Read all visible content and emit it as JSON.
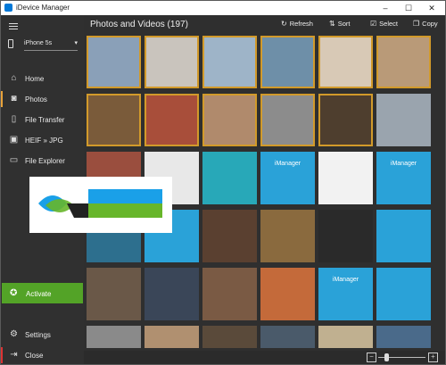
{
  "window": {
    "title": "iDevice Manager",
    "controls": [
      "–",
      "☐",
      "✕"
    ]
  },
  "sidebar": {
    "device": {
      "name": "iPhone 5s"
    },
    "nav": [
      {
        "label": "Home",
        "icon": "home-icon"
      },
      {
        "label": "Photos",
        "icon": "camera-icon"
      },
      {
        "label": "File Transfer",
        "icon": "phone-icon"
      },
      {
        "label": "HEIF » JPG",
        "icon": "image-icon"
      },
      {
        "label": "File Explorer",
        "icon": "folder-icon"
      }
    ],
    "activate": {
      "label": "Activate",
      "icon": "award-icon"
    },
    "settings": {
      "label": "Settings",
      "icon": "gear-icon"
    },
    "close": {
      "label": "Close",
      "icon": "exit-icon"
    }
  },
  "main": {
    "heading": "Photos and Videos (197)",
    "toolbar": {
      "refresh": "Refresh",
      "sort": "Sort",
      "select": "Select",
      "copy": "Copy"
    }
  },
  "photos": {
    "tiles": [
      {
        "color": "#8aa0b8",
        "selected": true
      },
      {
        "color": "#c9c4bd",
        "selected": true
      },
      {
        "color": "#9eb4c8",
        "selected": true
      },
      {
        "color": "#6e8fa8",
        "selected": true
      },
      {
        "color": "#d8c9b6",
        "selected": true
      },
      {
        "color": "#b99a78",
        "selected": true
      },
      {
        "color": "#7a5b3a",
        "selected": true
      },
      {
        "color": "#a84e3a",
        "selected": true
      },
      {
        "color": "#b08a6c",
        "selected": true
      },
      {
        "color": "#8c8c8c",
        "selected": true
      },
      {
        "color": "#4e3e2e",
        "selected": true
      },
      {
        "color": "#9aa4ae",
        "selected": false
      },
      {
        "color": "#9a4e3e",
        "selected": false
      },
      {
        "color": "#e8e8e8",
        "selected": false
      },
      {
        "color": "#28a8b8",
        "selected": false
      },
      {
        "color": "#2aa2d8",
        "text": "iManager",
        "selected": false
      },
      {
        "color": "#f2f2f2",
        "selected": false
      },
      {
        "color": "#2aa2d8",
        "text": "iManager",
        "selected": false
      },
      {
        "color": "#2d6f8e",
        "selected": false
      },
      {
        "color": "#2aa2d8",
        "selected": false
      },
      {
        "color": "#5a4030",
        "selected": false
      },
      {
        "color": "#8a6a3e",
        "selected": false
      },
      {
        "color": "#2a2a2a",
        "selected": false
      },
      {
        "color": "#2aa2d8",
        "selected": false
      },
      {
        "color": "#6a5848",
        "selected": false
      },
      {
        "color": "#3a4658",
        "selected": false
      },
      {
        "color": "#7a5a44",
        "selected": false
      },
      {
        "color": "#c46a3a",
        "selected": false
      },
      {
        "color": "#2aa2d8",
        "text": "iManager",
        "selected": false
      },
      {
        "color": "#2aa2d8",
        "selected": false
      },
      {
        "color": "#8a8a8a",
        "selected": false
      },
      {
        "color": "#b09070",
        "selected": false
      },
      {
        "color": "#5a4a3a",
        "selected": false
      },
      {
        "color": "#4a5a6a",
        "selected": false
      },
      {
        "color": "#c0b090",
        "selected": false
      },
      {
        "color": "#4a6a8a",
        "selected": false
      }
    ]
  },
  "zoom": {
    "minus": "−",
    "plus": "+",
    "level": 0.15
  }
}
